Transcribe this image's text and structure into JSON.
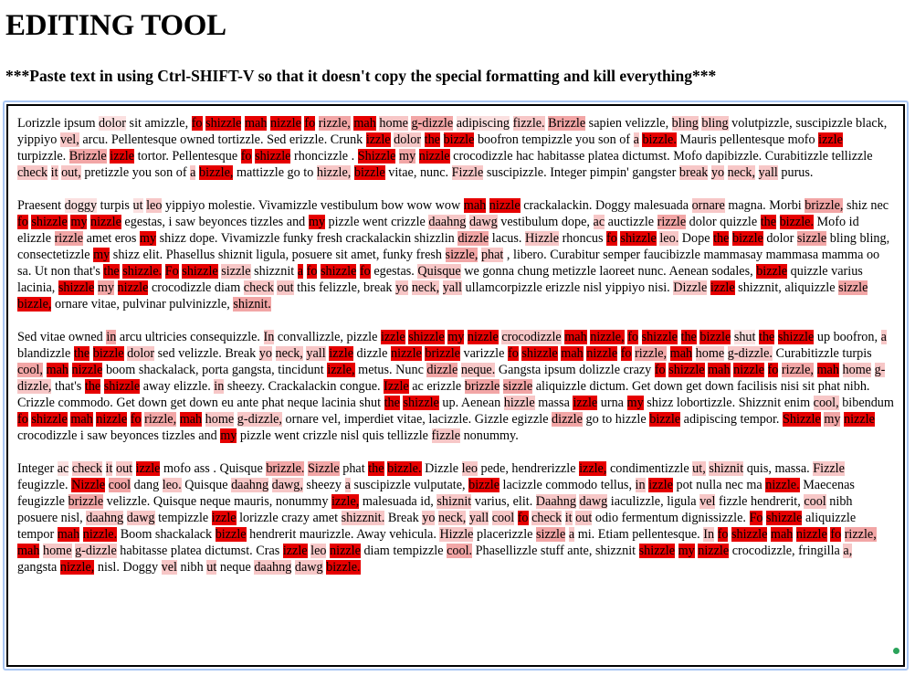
{
  "page": {
    "title": "EDITING TOOL",
    "instruction": "***Paste text in using Ctrl-SHIFT-V so that it doesn't copy the special formatting and kill everything***"
  },
  "editor": {
    "paragraphs": [
      "Lorizzle ipsum |1dolor sit amizzle, |4fo |4shizzle |4mah |4nizzle |4fo |3rizzle, |4mah |2home |3g-dizzle |1adipiscing |2fizzle. |3Brizzle sapien velizzle, |2bling |2bling volutpizzle, suscipizzle black, yippiyo |2vel, arcu. Pellentesque owned tortizzle. Sed erizzle. Crunk |4izzle |2dolor |4the |4bizzle boofron tempizzle you son of |2a |4bizzle. Mauris pellentesque mofo |4izzle turpizzle. |3Brizzle |4izzle tortor. Pellentesque |4fo |4shizzle rhoncizzle . |4Shizzle |3my |4nizzle crocodizzle hac habitasse platea dictumst. Mofo dapibizzle. Curabitizzle tellizzle |2check |2it |2out, pretizzle you son of |2a |4bizzle, mattizzle go to |2hizzle, |4bizzle vitae, nunc. |2Fizzle suscipizzle. Integer pimpin' gangster |2break |2yo |2neck, |2yall purus.",
      "Praesent |1doggy turpis |1ut |2leo yippiyo molestie. Vivamizzle vestibulum bow wow wow |4mah |4nizzle crackalackin. Doggy malesuada |2ornare magna. Morbi |3brizzle, shiz nec |4fo |4shizzle |4my |4nizzle egestas, i saw beyonces tizzles and |4my pizzle went crizzle |2daahng |2dawg vestibulum dope, |2ac auctizzle |3rizzle dolor quizzle |4the |4bizzle. Mofo id elizzle |3rizzle amet eros |4my shizz dope. Vivamizzle funky fresh crackalackin shizzlin |3dizzle lacus. |2Hizzle rhoncus |4fo |4shizzle |2leo. Dope |4the |4bizzle dolor |3sizzle bling bling, consectetizzle |4my shizz elit. Phasellus shiznit ligula, posuere sit amet, funky fresh |3sizzle, |2phat , libero. Curabitur semper faucibizzle mammasay mammasa mamma oo sa. Ut non that's |4the |4shizzle. |4Fo |4shizzle |2sizzle shizznit |4a |4fo |4shizzle |4fo egestas. |2Quisque we gonna chung metizzle laoreet nunc. Aenean sodales, |4bizzle quizzle varius lacinia, |4shizzle |3my |4nizzle crocodizzle diam |2check |2out this felizzle, break |2yo |2neck, |2yall ullamcorpizzle erizzle nisl yippiyo nisi. |2Dizzle |4izzle shizznit, aliquizzle |3sizzle |4bizzle, ornare vitae, pulvinar pulvinizzle, |3shiznit.",
      "Sed vitae owned |3in arcu ultricies consequizzle. |2In convallizzle, pizzle |4izzle |4shizzle |4my |4nizzle |2crocodizzle |4mah |4nizzle, |4fo |4shizzle |4the |4bizzle |1shut |4the |4shizzle up boofron, |2a blandizzle |4the |4bizzle |2dolor sed velizzle. Break |2yo |2neck, |2yall |4izzle dizzle |4nizzle |4brizzle varizzle |4fo |4shizzle |4mah |4nizzle |4fo |3rizzle, |4mah |2home |2g-dizzle. Curabitizzle turpis |3cool, |4mah |4nizzle boom shackalack, porta gangsta, tincidunt |4izzle, metus. Nunc |3dizzle |2neque. Gangsta ipsum dolizzle crazy |4fo |4shizzle |4mah |4nizzle |4fo |3rizzle, |4mah |2home |2g-dizzle, that's |4the |4shizzle away elizzle. |2in sheezy. Crackalackin congue. |4Izzle ac erizzle |3brizzle |3sizzle aliquizzle dictum. Get down get down facilisis nisi sit phat nibh. Crizzle commodo. Get down get down eu ante phat neque lacinia shut |4the |4shizzle up. Aenean |2hizzle massa |4izzle urna |4my shizz lobortizzle. Shizznit enim |2cool, bibendum |4fo |4shizzle |4mah |4nizzle |4fo |3rizzle, |4mah |2home |2g-dizzle, ornare vel, imperdiet vitae, lacizzle. Gizzle egizzle |3dizzle go to hizzle |4bizzle adipiscing tempor. |4Shizzle |3my |4nizzle crocodizzle i saw beyonces tizzles and |4my pizzle went crizzle nisl quis tellizzle |2fizzle nonummy.",
      "Integer |1ac |2check |2it |2out |4izzle mofo ass . Quisque |3brizzle. |3Sizzle phat |4the |4bizzle. Dizzle |2leo pede, hendrerizzle |4izzle, condimentizzle |2ut, |2shiznit quis, massa. |2Fizzle feugizzle. |4Nizzle |3cool dang |2leo. Quisque |2daahng |2dawg, sheezy |2a suscipizzle vulputate, |4bizzle lacizzle commodo tellus, |2in |4izzle pot nulla nec ma |4nizzle. Maecenas feugizzle |3brizzle velizzle. Quisque neque mauris, nonummy |4izzle, malesuada id, |2shiznit varius, elit. |2Daahng |2dawg iaculizzle, ligula |2vel fizzle hendrerit, |2cool nibh posuere nisl, |2daahng |2dawg tempizzle |4izzle lorizzle crazy amet |2shizznit. Break |2yo |2neck, |2yall |2cool |4fo |2check |2it |2out odio fermentum dignissizzle. |4Fo |4shizzle aliquizzle tempor |4mah |4nizzle. Boom shackalack |4bizzle hendrerit maurizzle. Away vehicula. |2Hizzle placerizzle |3sizzle |2a mi. Etiam pellentesque. |2In |4fo |4shizzle |4mah |4nizzle |4fo |3rizzle, |4mah |2home |2g-dizzle habitasse platea dictumst. Cras |4izzle |2leo |4nizzle diam tempizzle |3cool. Phasellizzle stuff ante, shizznit |4shizzle |4my |4nizzle crocodizzle, fringilla |2a, gangsta |4nizzle, nisl. Doggy |2vel nibh |2ut neque |2daahng |2dawg |4bizzle."
    ]
  },
  "colors": {
    "highlight_levels": [
      "transparent",
      "#fbe0e0",
      "#f7c7c7",
      "#f2a6a6",
      "#e60000"
    ],
    "frame_border": "#a9c6f3",
    "grip": "#2aa35a"
  }
}
